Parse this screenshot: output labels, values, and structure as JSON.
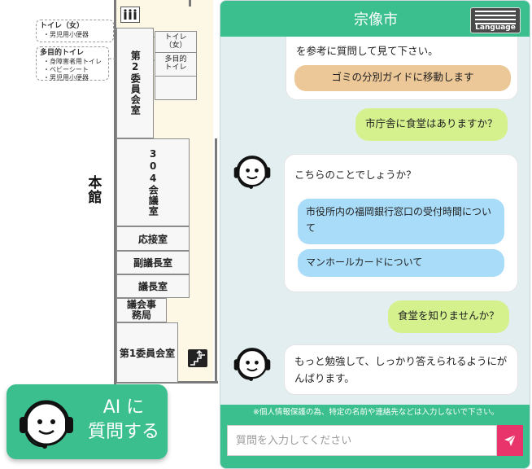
{
  "map": {
    "building_label": "本館",
    "rooms": {
      "room2": "第2委員会室",
      "room304": "304会議室",
      "reception": "応接室",
      "vice_chair": "副議長室",
      "chair": "議長室",
      "secretariat": "議会事務局",
      "room1": "第1委員会室",
      "toilet_women": "トイレ（女）",
      "multi_toilet": "多目的トイレ"
    },
    "callout_women": {
      "title": "トイレ（女）",
      "items": [
        "・男児用小便器"
      ]
    },
    "callout_multi": {
      "title": "多目的トイレ",
      "items": [
        "・身障害者用トイレ",
        "・ベビーシート",
        "・男児用小便器"
      ]
    }
  },
  "ai_button": {
    "line1": "AI に",
    "line2": "質問する"
  },
  "chat": {
    "title": "宗像市",
    "language_label": "Language",
    "messages": {
      "bot1_text": "を参考に質問して見て下さい。",
      "bot1_button": "ゴミの分別ガイドに移動します",
      "user1": "市庁舎に食堂はありますか？",
      "bot2_text": "こちらのことでしょうか？",
      "bot2_choices": [
        "市役所内の福岡銀行窓口の受付時間について",
        "マンホールカードについて"
      ],
      "user2": "食堂を知りませんか？",
      "bot3_text": "もっと勉強して、しっかり答えられるようにがんばります。"
    },
    "notice": "※個人情報保護の為、特定の名前や連絡先などは入力しないで下さい。",
    "input_placeholder": "質問を入力してください"
  },
  "colors": {
    "brand_green": "#3bbf8e",
    "user_bubble": "#d5f18e",
    "choice_blue": "#a9dcf8",
    "guide_orange": "#ecc797",
    "send_pink": "#e8336b"
  }
}
